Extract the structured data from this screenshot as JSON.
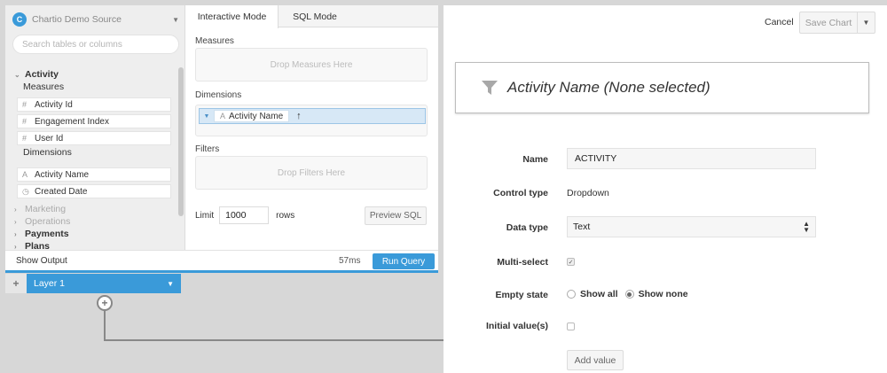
{
  "source": {
    "name": "Chartio Demo Source",
    "logo_letter": "C"
  },
  "schema": {
    "search_placeholder": "Search tables or columns",
    "table": "Activity",
    "measures_label": "Measures",
    "measures": [
      {
        "icon": "#",
        "label": "Activity Id"
      },
      {
        "icon": "#",
        "label": "Engagement Index"
      },
      {
        "icon": "#",
        "label": "User Id"
      }
    ],
    "dimensions_label": "Dimensions",
    "dimensions": [
      {
        "icon": "A",
        "label": "Activity Name"
      },
      {
        "icon": "◷",
        "label": "Created Date"
      }
    ],
    "other_tables": [
      {
        "label": "Marketing",
        "dim": true
      },
      {
        "label": "Operations",
        "dim": true
      },
      {
        "label": "Payments",
        "dim": false
      },
      {
        "label": "Plans",
        "dim": false
      }
    ]
  },
  "tabs": {
    "interactive": "Interactive Mode",
    "sql": "SQL Mode"
  },
  "query": {
    "measures_label": "Measures",
    "measures_drop": "Drop Measures Here",
    "dimensions_label": "Dimensions",
    "dimension_pill": "Activity Name",
    "filters_label": "Filters",
    "filters_drop": "Drop Filters Here",
    "limit_label": "Limit",
    "limit_value": "1000",
    "rows_label": "rows",
    "preview_sql": "Preview SQL"
  },
  "output": {
    "show_output": "Show Output",
    "runtime": "57ms",
    "run_query": "Run Query"
  },
  "layer": {
    "add": "+",
    "name": "Layer 1"
  },
  "editor": {
    "cancel": "Cancel",
    "save_chart": "Save Chart",
    "preview_title": "Activity Name (None selected)",
    "form": {
      "name_label": "Name",
      "name_value": "ACTIVITY",
      "control_type_label": "Control type",
      "control_type_value": "Dropdown",
      "data_type_label": "Data type",
      "data_type_value": "Text",
      "multi_select_label": "Multi-select",
      "multi_select_checked": true,
      "empty_state_label": "Empty state",
      "empty_state_show_all": "Show all",
      "empty_state_show_none": "Show none",
      "empty_state_selected": "show_none",
      "initial_values_label": "Initial value(s)",
      "initial_values_checked": false,
      "add_value": "Add value"
    }
  },
  "colors": {
    "accent": "#3a9ad9",
    "panel_bg": "#eeeeee",
    "canvas_bg": "#d7d7d7"
  }
}
